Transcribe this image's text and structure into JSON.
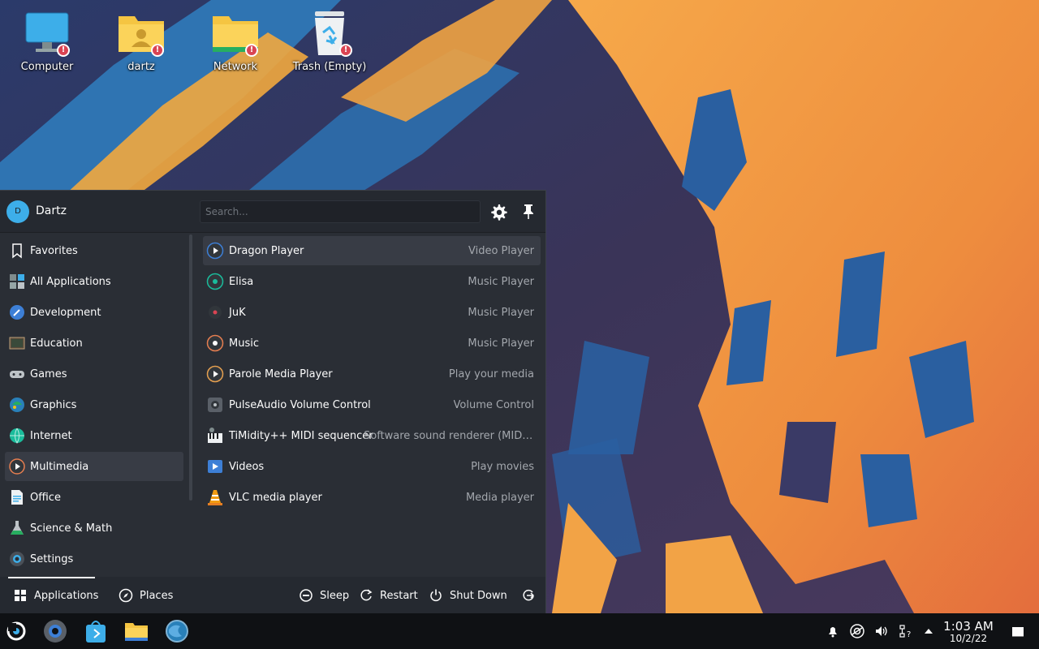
{
  "desktop": {
    "icons": [
      {
        "label": "Computer",
        "icon": "computer-icon"
      },
      {
        "label": "dartz",
        "icon": "home-folder-icon"
      },
      {
        "label": "Network",
        "icon": "network-folder-icon"
      },
      {
        "label": "Trash (Empty)",
        "icon": "trash-icon"
      }
    ]
  },
  "launcher": {
    "user": {
      "initial": "D",
      "name": "Dartz"
    },
    "search": {
      "placeholder": "Search..."
    },
    "categories": [
      {
        "label": "Favorites",
        "icon": "bookmark-icon"
      },
      {
        "label": "All Applications",
        "icon": "all-apps-icon"
      },
      {
        "label": "Development",
        "icon": "development-icon"
      },
      {
        "label": "Education",
        "icon": "education-icon"
      },
      {
        "label": "Games",
        "icon": "gamepad-icon"
      },
      {
        "label": "Graphics",
        "icon": "graphics-icon"
      },
      {
        "label": "Internet",
        "icon": "globe-icon"
      },
      {
        "label": "Multimedia",
        "icon": "multimedia-icon"
      },
      {
        "label": "Office",
        "icon": "office-icon"
      },
      {
        "label": "Science & Math",
        "icon": "science-icon"
      },
      {
        "label": "Settings",
        "icon": "settings-icon"
      }
    ],
    "selected_category": "Multimedia",
    "apps": [
      {
        "name": "Dragon Player",
        "desc": "Video Player",
        "icon": "dragon-player-icon"
      },
      {
        "name": "Elisa",
        "desc": "Music Player",
        "icon": "elisa-icon"
      },
      {
        "name": "JuK",
        "desc": "Music Player",
        "icon": "juk-icon"
      },
      {
        "name": "Music",
        "desc": "Music Player",
        "icon": "music-icon"
      },
      {
        "name": "Parole Media Player",
        "desc": "Play your media",
        "icon": "parole-icon"
      },
      {
        "name": "PulseAudio Volume Control",
        "desc": "Volume Control",
        "icon": "pulseaudio-icon"
      },
      {
        "name": "TiMidity++ MIDI sequencer",
        "desc": "Software sound renderer (MIDI ...",
        "icon": "timidity-icon"
      },
      {
        "name": "Videos",
        "desc": "Play movies",
        "icon": "videos-icon"
      },
      {
        "name": "VLC media player",
        "desc": "Media player",
        "icon": "vlc-icon"
      }
    ],
    "footer": {
      "applications_label": "Applications",
      "places_label": "Places",
      "sleep_label": "Sleep",
      "restart_label": "Restart",
      "shutdown_label": "Shut Down"
    }
  },
  "panel": {
    "launchers": [
      "app-launcher-icon",
      "system-settings-icon",
      "discover-icon",
      "file-manager-icon",
      "web-browser-icon"
    ],
    "clock": {
      "time": "1:03 AM",
      "date": "10/2/22"
    }
  },
  "colors": {
    "accent": "#3daee9",
    "panel": "#0f1114",
    "launcher_bg": "#2a2e35",
    "warning": "#da4453"
  }
}
